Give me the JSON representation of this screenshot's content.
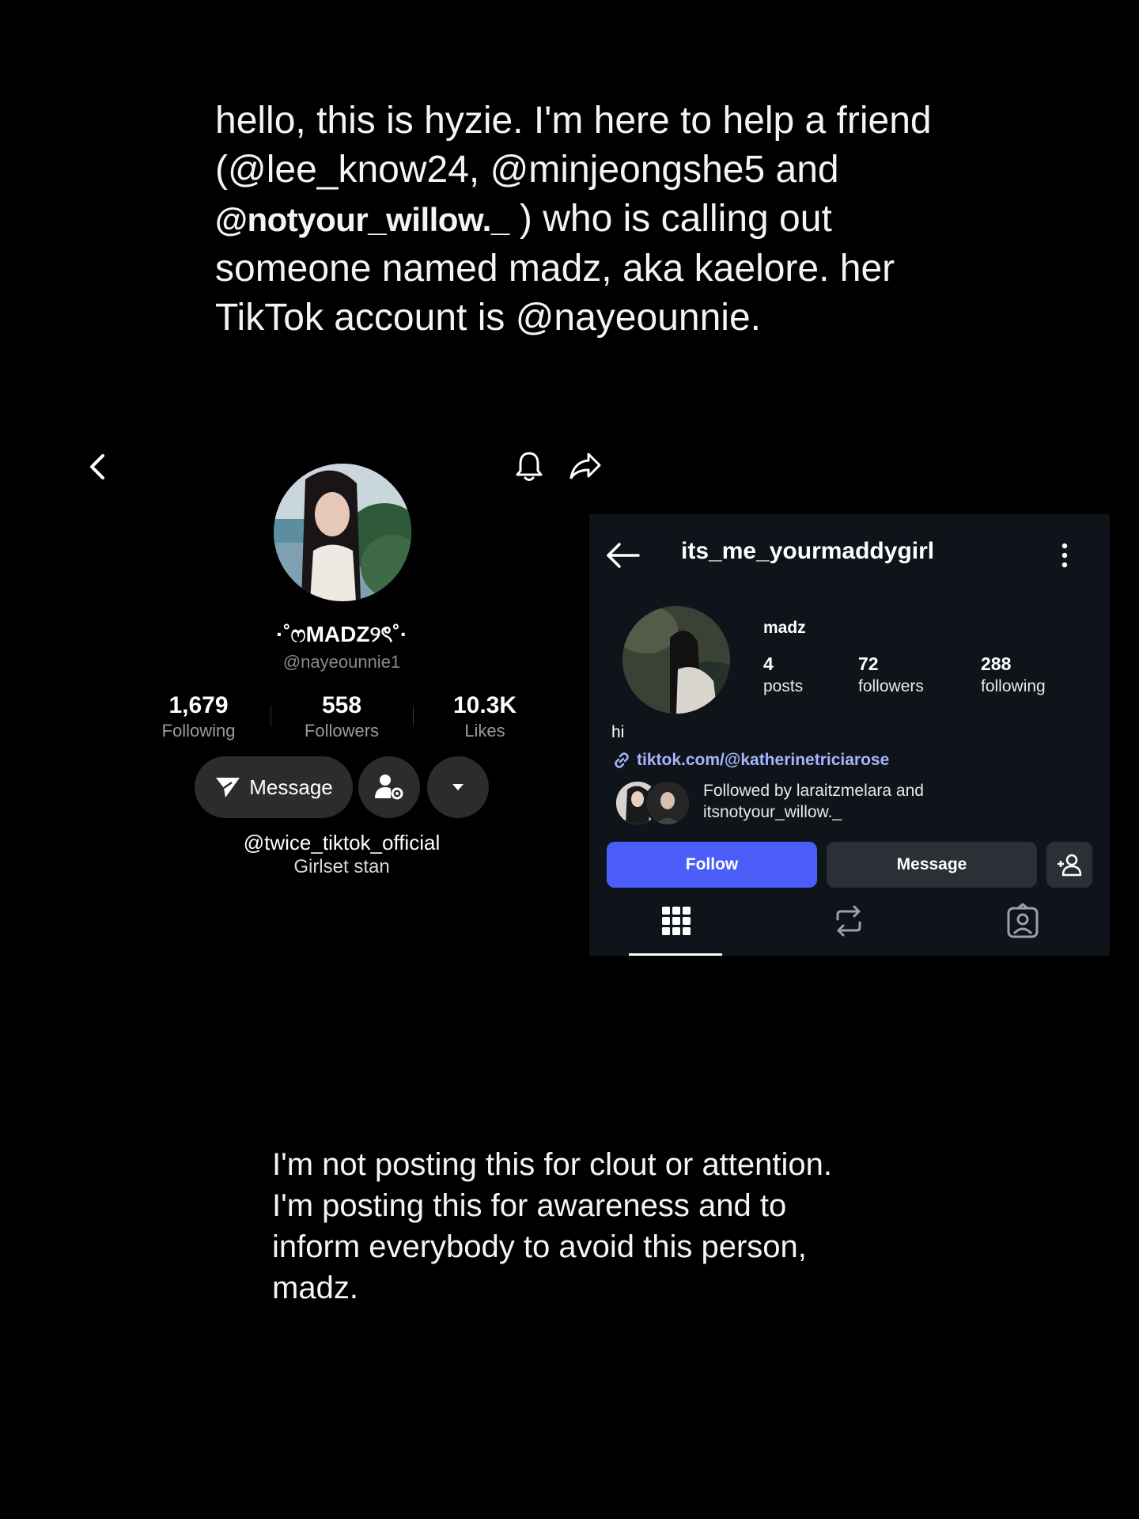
{
  "intro": {
    "line1": "hello, this is hyzie. I'm here to help a friend",
    "line2": "(@lee_know24, @minjeongshe5 and",
    "line3_handle": "@notyour_willow._",
    "line3_rest": " ) who is calling out",
    "line4": "someone named madz, aka kaelore. her",
    "line5": "TikTok account is @nayeounnie."
  },
  "tiktok": {
    "display_name": "·˚ෆMADZ୨ৎ˚·",
    "handle": "@nayeounnie1",
    "stats": [
      {
        "num": "1,679",
        "label": "Following"
      },
      {
        "num": "558",
        "label": "Followers"
      },
      {
        "num": "10.3K",
        "label": "Likes"
      }
    ],
    "message_label": "Message",
    "bio_handle": "@twice_tiktok_official",
    "bio_text": "Girlset stan",
    "icons": {
      "back": "back-chevron-icon",
      "bell": "bell-icon",
      "share": "share-icon"
    }
  },
  "instagram": {
    "username": "its_me_yourmaddygirl",
    "name": "madz",
    "stats": [
      {
        "num": "4",
        "label": "posts"
      },
      {
        "num": "72",
        "label": "followers"
      },
      {
        "num": "288",
        "label": "following"
      }
    ],
    "bio": "hi",
    "link": "tiktok.com/@katherinetriciarose",
    "followed_line1": "Followed by laraitzmelara and",
    "followed_line2": "itsnotyour_willow._",
    "follow_label": "Follow",
    "message_label": "Message",
    "accent": "#4a5df9",
    "link_color": "#a5b4fc"
  },
  "outro": {
    "line1": "I'm not posting this for clout or attention.",
    "line2": "I'm posting this for awareness and to",
    "line3": "inform everybody to avoid this person,",
    "line4": "madz."
  }
}
